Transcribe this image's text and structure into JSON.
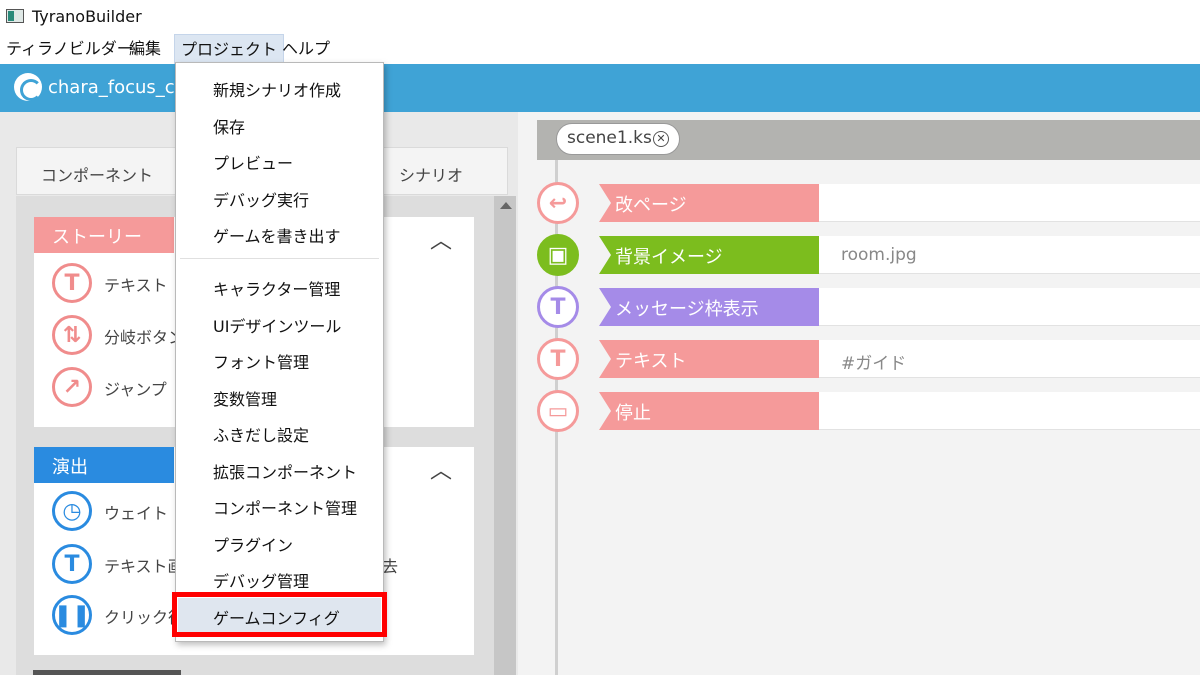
{
  "window": {
    "title": "TyranoBuilder"
  },
  "menubar": {
    "items": [
      "ティラノビルダー",
      "編集",
      "プロジェクト",
      "ヘルプ"
    ]
  },
  "project": {
    "name": "chara_focus_cu"
  },
  "left_tabs": {
    "components": "コンポーネント",
    "scenario": "シナリオ"
  },
  "groups": {
    "story": {
      "title": "ストーリー",
      "color": "#f59a9a",
      "items": [
        "テキスト",
        "分岐ボタン",
        "ジャンプ"
      ]
    },
    "effects": {
      "title": "演出",
      "color": "#2a8be0",
      "items": [
        "ウェイト",
        "テキスト画",
        "クリック待",
        "去"
      ]
    }
  },
  "scene": {
    "tab": "scene1.ks",
    "rows": [
      {
        "label": "改ページ",
        "value": "",
        "color": "#f59a9a",
        "icon": "page-return-icon"
      },
      {
        "label": "背景イメージ",
        "value": "room.jpg",
        "color": "#7cbd1e",
        "icon": "background-image-icon"
      },
      {
        "label": "メッセージ枠表示",
        "value": "",
        "color": "#a58be8",
        "icon": "message-frame-icon"
      },
      {
        "label": "テキスト",
        "value": "#ガイド",
        "color": "#f59a9a",
        "icon": "text-icon"
      },
      {
        "label": "停止",
        "value": "",
        "color": "#f59a9a",
        "icon": "stop-icon"
      }
    ]
  },
  "dropdown": {
    "items": [
      "新規シナリオ作成",
      "保存",
      "プレビュー",
      "デバッグ実行",
      "ゲームを書き出す",
      "キャラクター管理",
      "UIデザインツール",
      "フォント管理",
      "変数管理",
      "ふきだし設定",
      "拡張コンポーネント",
      "コンポーネント管理",
      "プラグイン",
      "デバッグ管理",
      "ゲームコンフィグ"
    ],
    "highlighted": "ゲームコンフィグ"
  }
}
